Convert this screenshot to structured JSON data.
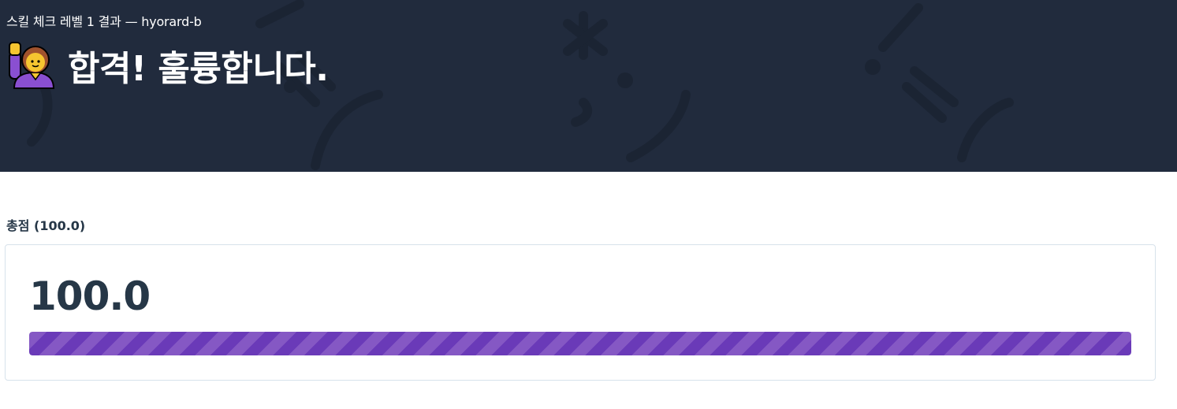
{
  "header": {
    "subtitle": "스킬 체크 레벨 1 결과 — hyorard-b",
    "title": "합격! 훌륭합니다.",
    "emoji_icon": "person-raising-hand-icon",
    "background_color": "#212b3d"
  },
  "score": {
    "label": "총점 (100.0)",
    "value": "100.0",
    "progress_percent": 100,
    "bar_color": "#6a3ab8"
  }
}
